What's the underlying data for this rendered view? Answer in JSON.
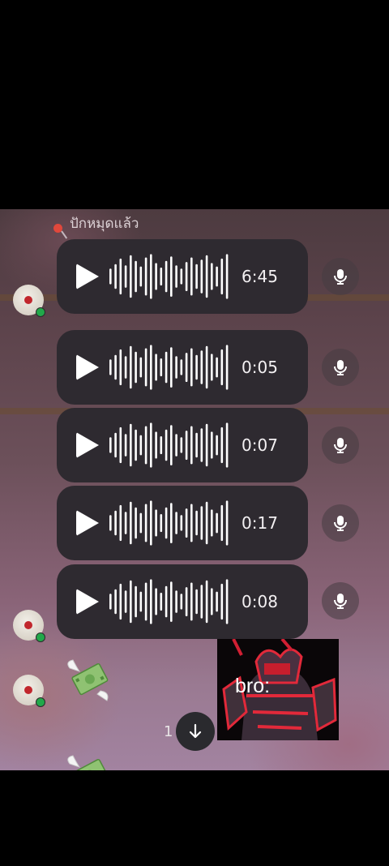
{
  "pinned": {
    "label": "ปักหมุดแล้ว"
  },
  "voice_messages": [
    {
      "duration": "6:45"
    },
    {
      "duration": "0:05"
    },
    {
      "duration": "0:07"
    },
    {
      "duration": "0:17"
    },
    {
      "duration": "0:08"
    }
  ],
  "sticker": {
    "text": "bro:"
  },
  "scroll": {
    "unread_count": "1"
  },
  "icons": {
    "play": "play-icon",
    "mic": "microphone-icon",
    "scroll_down": "arrow-down-icon",
    "money": "money-with-wings-emoji"
  },
  "colors": {
    "bubble": "#2e2a30",
    "online": "#22a84a",
    "pin": "#e0483c"
  }
}
